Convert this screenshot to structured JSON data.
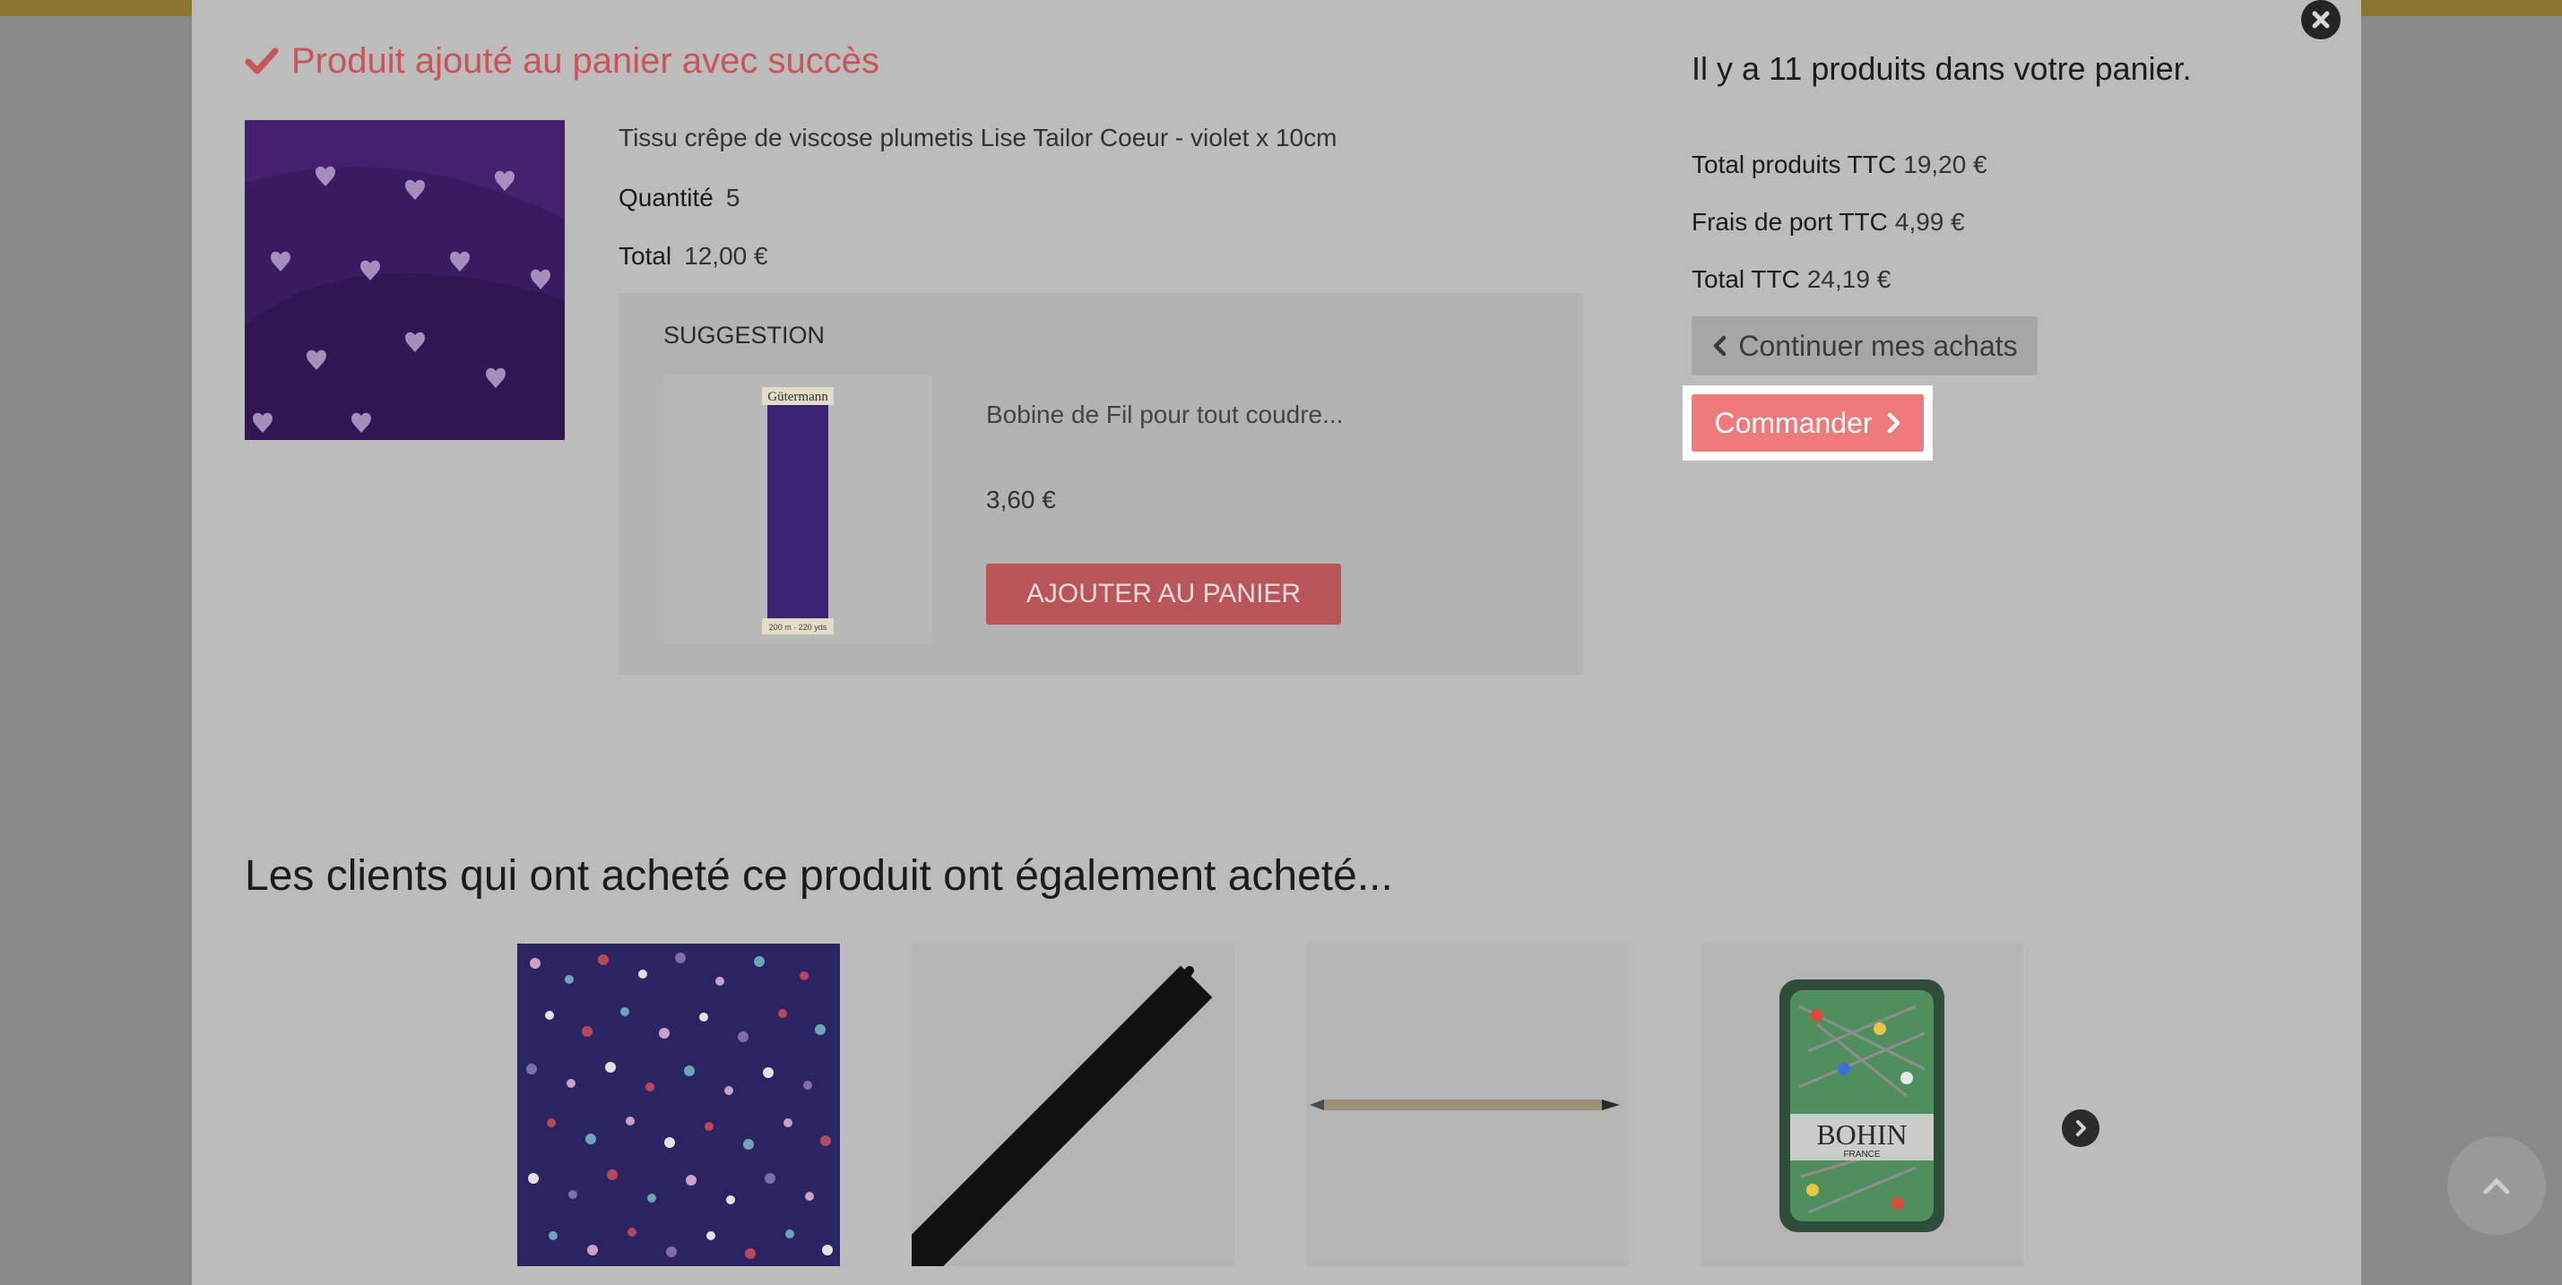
{
  "modal": {
    "success_message": "Produit ajouté au panier avec succès",
    "product": {
      "name": "Tissu crêpe de viscose plumetis Lise Tailor Coeur - violet x 10cm",
      "quantity_label": "Quantité",
      "quantity_value": "5",
      "total_label": "Total",
      "total_value": "12,00 €"
    },
    "suggestion": {
      "title": "SUGGESTION",
      "product_name": "Bobine de Fil pour tout coudre...",
      "price": "3,60 €",
      "add_button": "AJOUTER AU PANIER",
      "spool_brand": "Gütermann",
      "spool_text": "200 m · 220 yds"
    },
    "cart": {
      "count_text": "Il y a 11 produits dans votre panier.",
      "total_products_label": "Total produits TTC",
      "total_products_value": "19,20 €",
      "shipping_label": "Frais de port TTC",
      "shipping_value": "4,99 €",
      "total_label": "Total TTC",
      "total_value": "24,19 €",
      "continue_button": "Continuer mes achats",
      "order_button": "Commander"
    },
    "also_bought": {
      "title": "Les clients qui ont acheté ce produit ont également acheté...",
      "bohin_brand": "BOHIN",
      "bohin_sub": "FRANCE"
    }
  },
  "icons": {
    "close": "close-icon",
    "check": "check-icon",
    "chevron_left": "chevron-left-icon",
    "chevron_right": "chevron-right-icon",
    "scroll_top": "chevron-up-icon"
  },
  "colors": {
    "accent_red": "#c9555b",
    "order_button": "#ef7a7d",
    "top_strip": "#8a7632"
  }
}
